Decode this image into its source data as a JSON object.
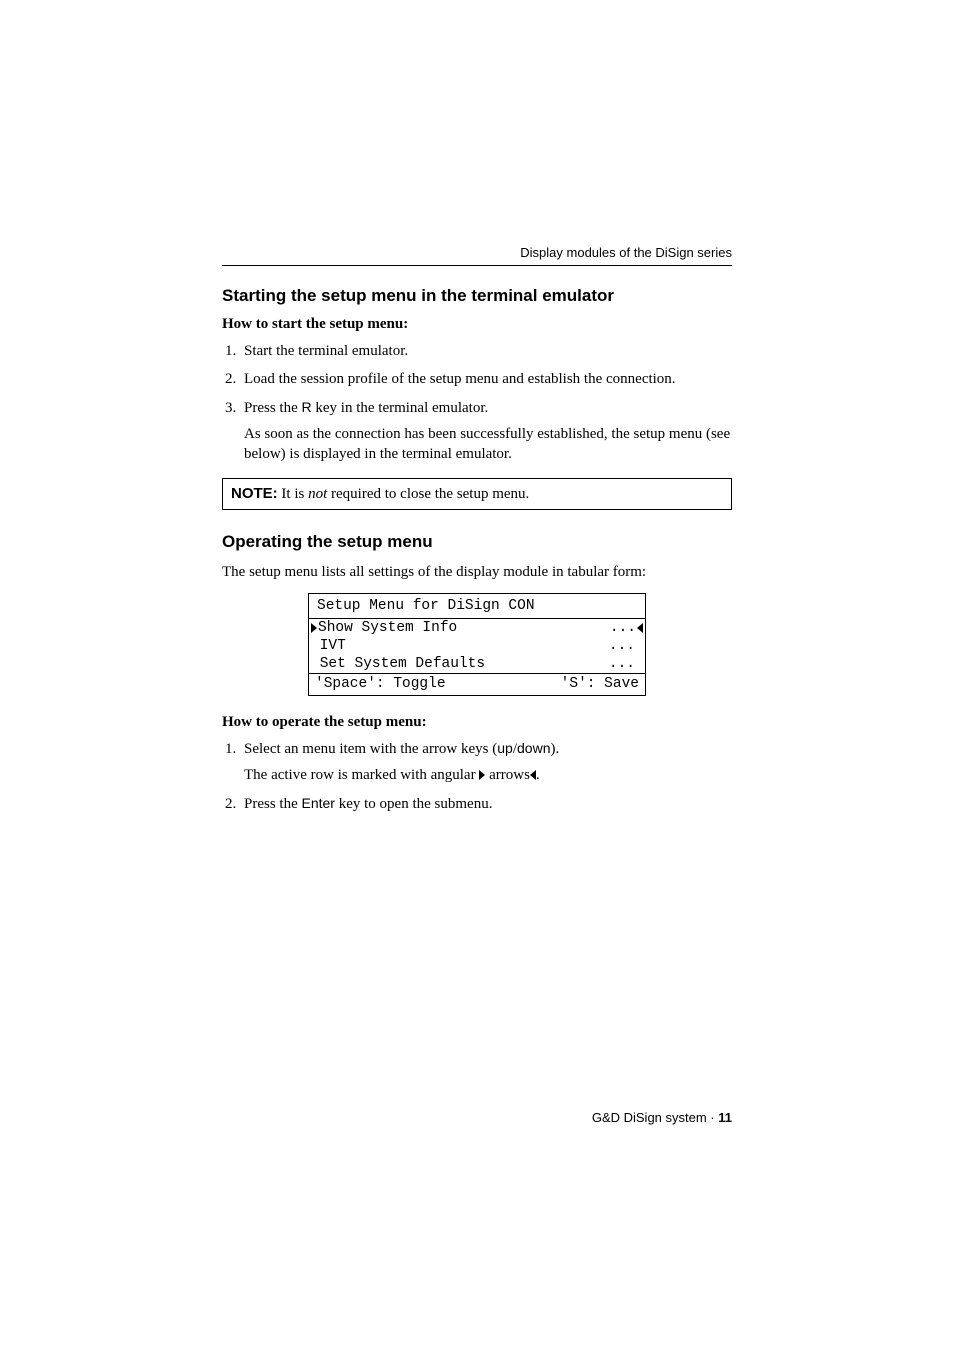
{
  "header": {
    "running": "Display modules of the DiSign series"
  },
  "section1": {
    "title": "Starting the setup menu in the terminal emulator",
    "lead": "How to start the setup menu:",
    "steps": {
      "s1": "Start the terminal emulator.",
      "s2": "Load the session profile of the setup menu and establish the connection.",
      "s3_pre": "Press the ",
      "s3_key": "R",
      "s3_post": " key in the terminal emulator.",
      "s3_sub": "As soon as the connection has been successfully established, the setup menu (see below) is displayed in the terminal emulator."
    },
    "note": {
      "label": "NOTE:",
      "pre": " It is ",
      "em": "not",
      "post": " required to close the setup menu."
    }
  },
  "section2": {
    "title": "Operating the setup menu",
    "intro": "The setup menu lists all settings of the display module in tabular form:",
    "terminal": {
      "title": "Setup Menu for DiSign CON",
      "rows": [
        {
          "label": "Show System Info",
          "trail": "...",
          "active": true
        },
        {
          "label": " IVT",
          "trail": "...",
          "active": false
        },
        {
          "label": " Set System Defaults",
          "trail": "...",
          "active": false
        }
      ],
      "footer_left": "'Space': Toggle",
      "footer_right": "'S': Save"
    },
    "lead": "How to operate the setup menu:",
    "steps": {
      "s1_pre": "Select an menu item with the arrow keys (",
      "s1_key": "up",
      "s1_mid": "/",
      "s1_key2": "down",
      "s1_post": ").",
      "s1_sub_pre": "The active row is marked with angular ",
      "s1_sub_mid": " arrows",
      "s1_sub_post": ".",
      "s2_pre": "Press the ",
      "s2_key": "Enter",
      "s2_post": " key to open the submenu."
    }
  },
  "footer": {
    "text": "G&D DiSign system · ",
    "page": "11"
  }
}
